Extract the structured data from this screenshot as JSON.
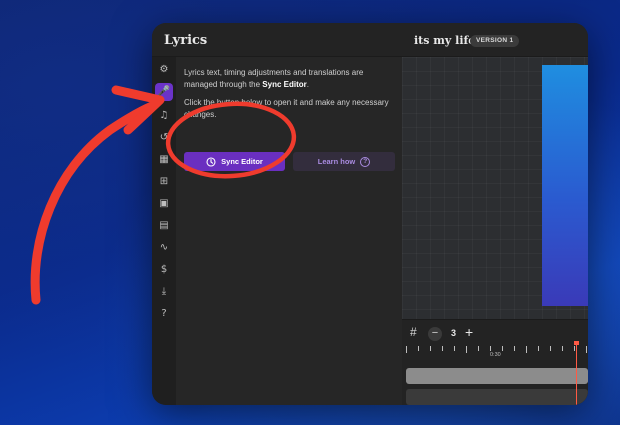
{
  "app": {
    "title": "Lyrics"
  },
  "header": {
    "song_title": "its my life",
    "version_badge": "VERSION 1"
  },
  "rail": {
    "items": [
      {
        "name": "settings",
        "icon": "gear-icon",
        "glyph": "⚙",
        "active": false
      },
      {
        "name": "lyrics",
        "icon": "microphone-icon",
        "glyph": "🎤",
        "active": true
      },
      {
        "name": "music",
        "icon": "music-note-icon",
        "glyph": "♫",
        "active": false
      },
      {
        "name": "history",
        "icon": "history-icon",
        "glyph": "↺",
        "active": false
      },
      {
        "name": "layout",
        "icon": "layout-icon",
        "glyph": "▦",
        "active": false
      },
      {
        "name": "text",
        "icon": "text-box-icon",
        "glyph": "⊞",
        "active": false
      },
      {
        "name": "image",
        "icon": "image-icon",
        "glyph": "▣",
        "active": false
      },
      {
        "name": "film",
        "icon": "film-icon",
        "glyph": "▤",
        "active": false
      },
      {
        "name": "waveform",
        "icon": "waveform-icon",
        "glyph": "∿",
        "active": false
      },
      {
        "name": "credit",
        "icon": "dollar-icon",
        "glyph": "$",
        "active": false
      },
      {
        "name": "download",
        "icon": "download-icon",
        "glyph": "⤓",
        "active": false
      },
      {
        "name": "help",
        "icon": "help-icon",
        "glyph": "?",
        "active": false
      }
    ]
  },
  "panel": {
    "description_1_prefix": "Lyrics text, timing adjustments and translations are managed through the ",
    "description_1_strong": "Sync Editor",
    "description_1_suffix": ".",
    "description_2": "Click the button below to open it and make any necessary changes.",
    "sync_button": "Sync Editor",
    "learn_button": "Learn how"
  },
  "timeline": {
    "zoom_value": "3",
    "time_label": "0:30"
  },
  "colors": {
    "accent": "#6a2fc0",
    "annotation": "#ef3b2d",
    "playhead": "#ff5a45"
  }
}
